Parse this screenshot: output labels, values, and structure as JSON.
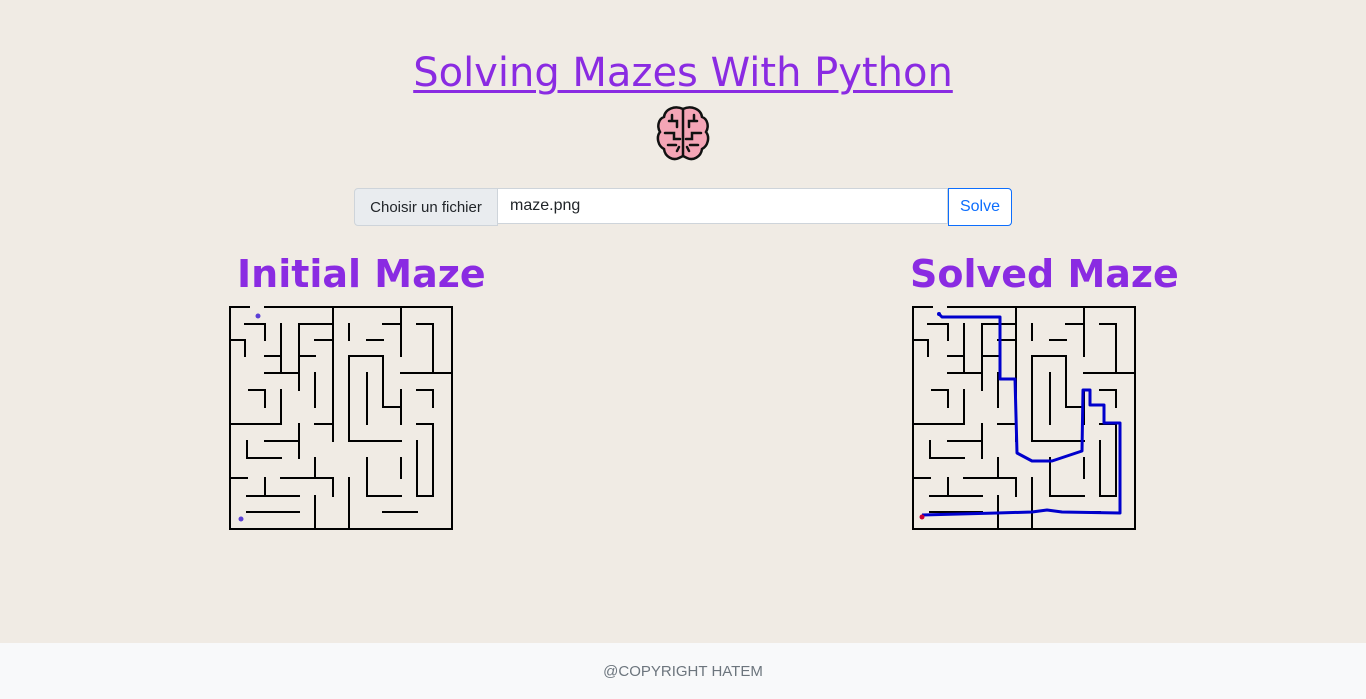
{
  "header": {
    "title": "Solving Mazes With Python",
    "logo_icon": "brain-icon"
  },
  "upload": {
    "choose_file_label": "Choisir un fichier",
    "file_name": "maze.png",
    "solve_label": "Solve"
  },
  "initial": {
    "heading": "Initial Maze"
  },
  "solved": {
    "heading": "Solved Maze"
  },
  "footer": {
    "text": "@COPYRIGHT HATEM"
  },
  "colors": {
    "accent": "#8a2be2",
    "background": "#f0ebe4",
    "path": "#0000cc",
    "button_outline": "#0d6efd"
  }
}
